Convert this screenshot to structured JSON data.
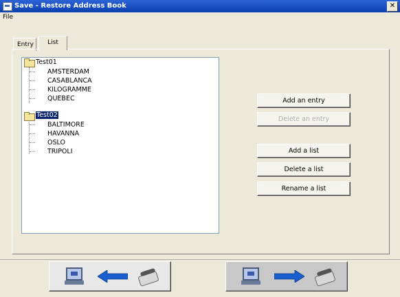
{
  "window": {
    "title": "Save - Restore Address Book"
  },
  "menu": {
    "file": "File"
  },
  "tabs": [
    {
      "label": "Entry"
    },
    {
      "label": "List"
    }
  ],
  "tree": {
    "lists": [
      {
        "label": "Test01",
        "entries": [
          "AMSTERDAM",
          "CASABLANCA",
          "KILOGRAMME",
          "QUEBEC"
        ]
      },
      {
        "label": "Test02",
        "entries": [
          "BALTIMORE",
          "HAVANNA",
          "OSLO",
          "TRIPOLI"
        ]
      }
    ]
  },
  "buttons": {
    "add_entry": "Add an entry",
    "delete_entry": "Delete an entry",
    "add_list": "Add a list",
    "delete_list": "Delete a list",
    "rename_list": "Rename a list"
  },
  "nav": {
    "left_icon": "computer-from-fax-arrow-icon",
    "right_icon": "computer-to-fax-arrow-icon"
  },
  "colors": {
    "title_bar": "#0a3fb0",
    "selection": "#0a246a",
    "arrow": "#1a5fd0"
  }
}
